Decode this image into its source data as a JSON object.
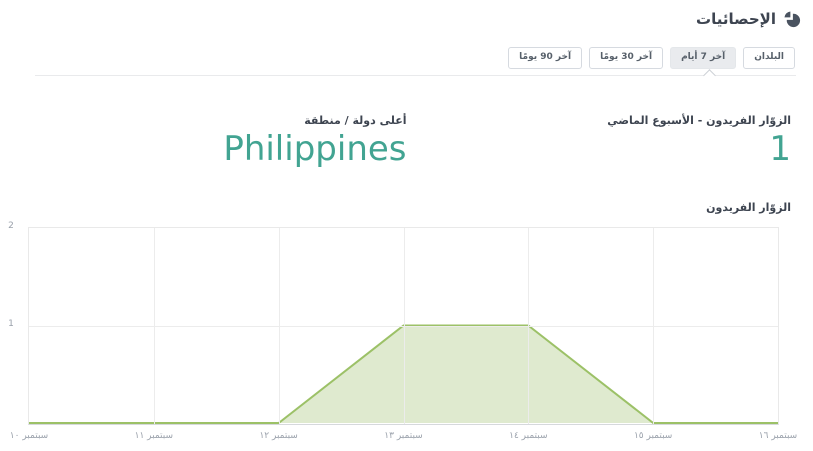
{
  "header": {
    "title": "الإحصائيات",
    "icon": "pie-chart"
  },
  "toolbar": {
    "buttons": [
      {
        "name": "countries-button",
        "label": "البلدان",
        "selected": false
      },
      {
        "name": "last-7-days-button",
        "label": "آخر 7 أيام",
        "selected": true
      },
      {
        "name": "last-30-days-button",
        "label": "آخر 30 يومًا",
        "selected": false
      },
      {
        "name": "last-90-days-button",
        "label": "آخر 90 يومًا",
        "selected": false
      }
    ]
  },
  "stats": [
    {
      "name": "unique-visitors-last-week",
      "label": "الزوّار الفريدون - الأسبوع الماضي",
      "value": "1"
    },
    {
      "name": "top-country-region",
      "label": "أعلى دولة / منطقة",
      "value": "Philippines"
    }
  ],
  "colors": {
    "accent_teal": "#42a492",
    "line_green": "#9cc167",
    "fill_green": "#dfeacf",
    "grid": "#ececec",
    "text_dark": "#3d4450",
    "axis_text": "#9aa1ab"
  },
  "chart_data": {
    "type": "area",
    "title": "الزوّار الفريدون",
    "categories": [
      "سبتمبر ١٠",
      "سبتمبر ١١",
      "سبتمبر ١٢",
      "سبتمبر ١٣",
      "سبتمبر ١٤",
      "سبتمبر ١٥",
      "سبتمبر ١٦"
    ],
    "values": [
      0,
      0,
      0,
      1,
      1,
      0,
      0
    ],
    "xlabel": "",
    "ylabel": "",
    "ylim": [
      0,
      2
    ],
    "yticks": [
      1,
      2
    ],
    "grid": true,
    "legend": false,
    "line_color": "#9cc167",
    "fill_color": "#dfeacf"
  }
}
